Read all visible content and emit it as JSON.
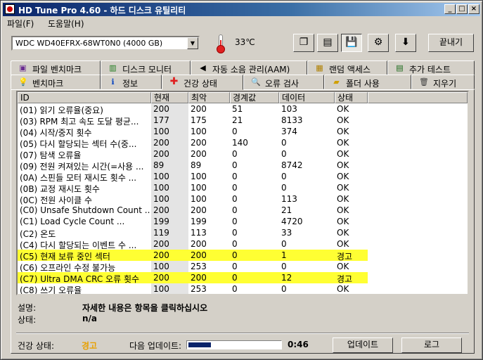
{
  "window": {
    "title": "HD Tune Pro 4.60 - 하드 디스크 유틸리티",
    "minimize": "_",
    "maximize": "□",
    "close": "×"
  },
  "menu": [
    "파일(F)",
    "도움말(H)"
  ],
  "toolbar": {
    "drive": "WDC  WD40EFRX-68WT0N0 (4000 GB)",
    "temperature": "33℃",
    "exit_label": "끝내기"
  },
  "tabs_top": [
    {
      "label": "파일 벤치마크",
      "icon": "file-benchmark-icon"
    },
    {
      "label": "디스크 모니터",
      "icon": "disk-monitor-icon"
    },
    {
      "label": "자동 소음 관리(AAM)",
      "icon": "speaker-icon"
    },
    {
      "label": "랜덤 액세스",
      "icon": "random-access-icon"
    },
    {
      "label": "추가 테스트",
      "icon": "extra-tests-icon"
    }
  ],
  "tabs_bottom": [
    {
      "label": "벤치마크",
      "icon": "benchmark-icon"
    },
    {
      "label": "정보",
      "icon": "info-icon"
    },
    {
      "label": "건강 상태",
      "icon": "health-cross-icon",
      "active": true
    },
    {
      "label": "오류 검사",
      "icon": "magnifier-icon"
    },
    {
      "label": "폴더 사용",
      "icon": "folder-icon"
    },
    {
      "label": "지우기",
      "icon": "trash-icon"
    }
  ],
  "columns": [
    "ID",
    "현재",
    "최악",
    "경계값",
    "데이터",
    "상태"
  ],
  "rows": [
    {
      "id": "(01) 읽기 오류율(중요)",
      "current": "200",
      "worst": "200",
      "threshold": "51",
      "data": "103",
      "status": "OK"
    },
    {
      "id": "(03) RPM 최고 속도 도달 평균...",
      "current": "177",
      "worst": "175",
      "threshold": "21",
      "data": "8133",
      "status": "OK"
    },
    {
      "id": "(04) 시작/중지 횟수",
      "current": "100",
      "worst": "100",
      "threshold": "0",
      "data": "374",
      "status": "OK"
    },
    {
      "id": "(05) 다시 할당되는 섹터 수(중...",
      "current": "200",
      "worst": "200",
      "threshold": "140",
      "data": "0",
      "status": "OK"
    },
    {
      "id": "(07) 탐색 오류율",
      "current": "200",
      "worst": "200",
      "threshold": "0",
      "data": "0",
      "status": "OK"
    },
    {
      "id": "(09) 전원 켜져있는 시간(=사용 ...",
      "current": "89",
      "worst": "89",
      "threshold": "0",
      "data": "8742",
      "status": "OK"
    },
    {
      "id": "(0A) 스핀들 모터 재시도 횟수 ...",
      "current": "100",
      "worst": "100",
      "threshold": "0",
      "data": "0",
      "status": "OK"
    },
    {
      "id": "(0B) 교정 재시도 횟수",
      "current": "100",
      "worst": "100",
      "threshold": "0",
      "data": "0",
      "status": "OK"
    },
    {
      "id": "(0C) 전원 사이클 수",
      "current": "100",
      "worst": "100",
      "threshold": "0",
      "data": "113",
      "status": "OK"
    },
    {
      "id": "(C0) Unsafe Shutdown Count ...",
      "current": "200",
      "worst": "200",
      "threshold": "0",
      "data": "21",
      "status": "OK"
    },
    {
      "id": "(C1) Load Cycle Count       ...",
      "current": "199",
      "worst": "199",
      "threshold": "0",
      "data": "4720",
      "status": "OK"
    },
    {
      "id": "(C2) 온도",
      "current": "119",
      "worst": "113",
      "threshold": "0",
      "data": "33",
      "status": "OK"
    },
    {
      "id": "(C4) 다시 할당되는 이벤트 수 ...",
      "current": "200",
      "worst": "200",
      "threshold": "0",
      "data": "0",
      "status": "OK"
    },
    {
      "id": "(C5) 현재 보류 중인 섹터",
      "current": "200",
      "worst": "200",
      "threshold": "0",
      "data": "1",
      "status": "경고",
      "warn": true
    },
    {
      "id": "(C6) 오프라인 수정 불가능",
      "current": "100",
      "worst": "253",
      "threshold": "0",
      "data": "0",
      "status": "OK"
    },
    {
      "id": "(C7) Ultra DMA CRC 오류 횟수",
      "current": "200",
      "worst": "200",
      "threshold": "0",
      "data": "12",
      "status": "경고",
      "warn": true
    },
    {
      "id": "(C8) 쓰기 오류율",
      "current": "100",
      "worst": "253",
      "threshold": "0",
      "data": "0",
      "status": "OK"
    }
  ],
  "details": {
    "desc_label": "설명:",
    "desc_value": "자세한 내용은 항목을 클릭하십시오",
    "status_label": "상태:",
    "status_value": "n/a"
  },
  "statusbar": {
    "health_label": "건강 상태:",
    "health_value": "경고",
    "next_update_label": "다음 업데이트:",
    "progress": 0.24,
    "countdown": "0:46",
    "update_button": "업데이트",
    "log_button": "로그"
  },
  "colors": {
    "warning_highlight": "#ffff33",
    "health_warning_text": "#e8a000"
  }
}
